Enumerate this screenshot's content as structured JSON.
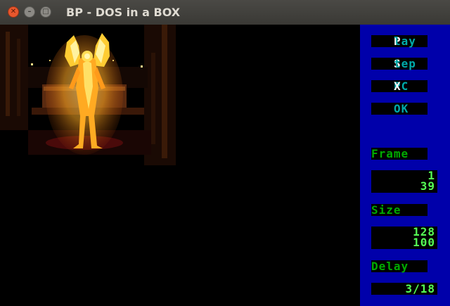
{
  "window": {
    "title": "BP - DOS in a BOX",
    "controls": {
      "close_icon": "close-icon",
      "min_icon": "minimize-icon",
      "max_icon": "maximize-icon"
    }
  },
  "image": {
    "description_icon": "fire-figure-image"
  },
  "panel": {
    "buttons": [
      {
        "hot": "P",
        "rest": "lay"
      },
      {
        "hot": "S",
        "rest": "tep"
      },
      {
        "hot": "PCX",
        "rest": ""
      },
      {
        "hot": "",
        "rest": "OK"
      }
    ],
    "frame": {
      "label": "Frame",
      "current": "1",
      "total": "39"
    },
    "size": {
      "label": "Size",
      "width": "128",
      "height": "100"
    },
    "delay": {
      "label": "Delay",
      "value": "3/18"
    }
  },
  "colors": {
    "panel_bg": "#0000aa",
    "hotkey": "#ffffff",
    "button_text": "#00aaaa",
    "label_text": "#00aa00",
    "value_text": "#55ff55"
  }
}
